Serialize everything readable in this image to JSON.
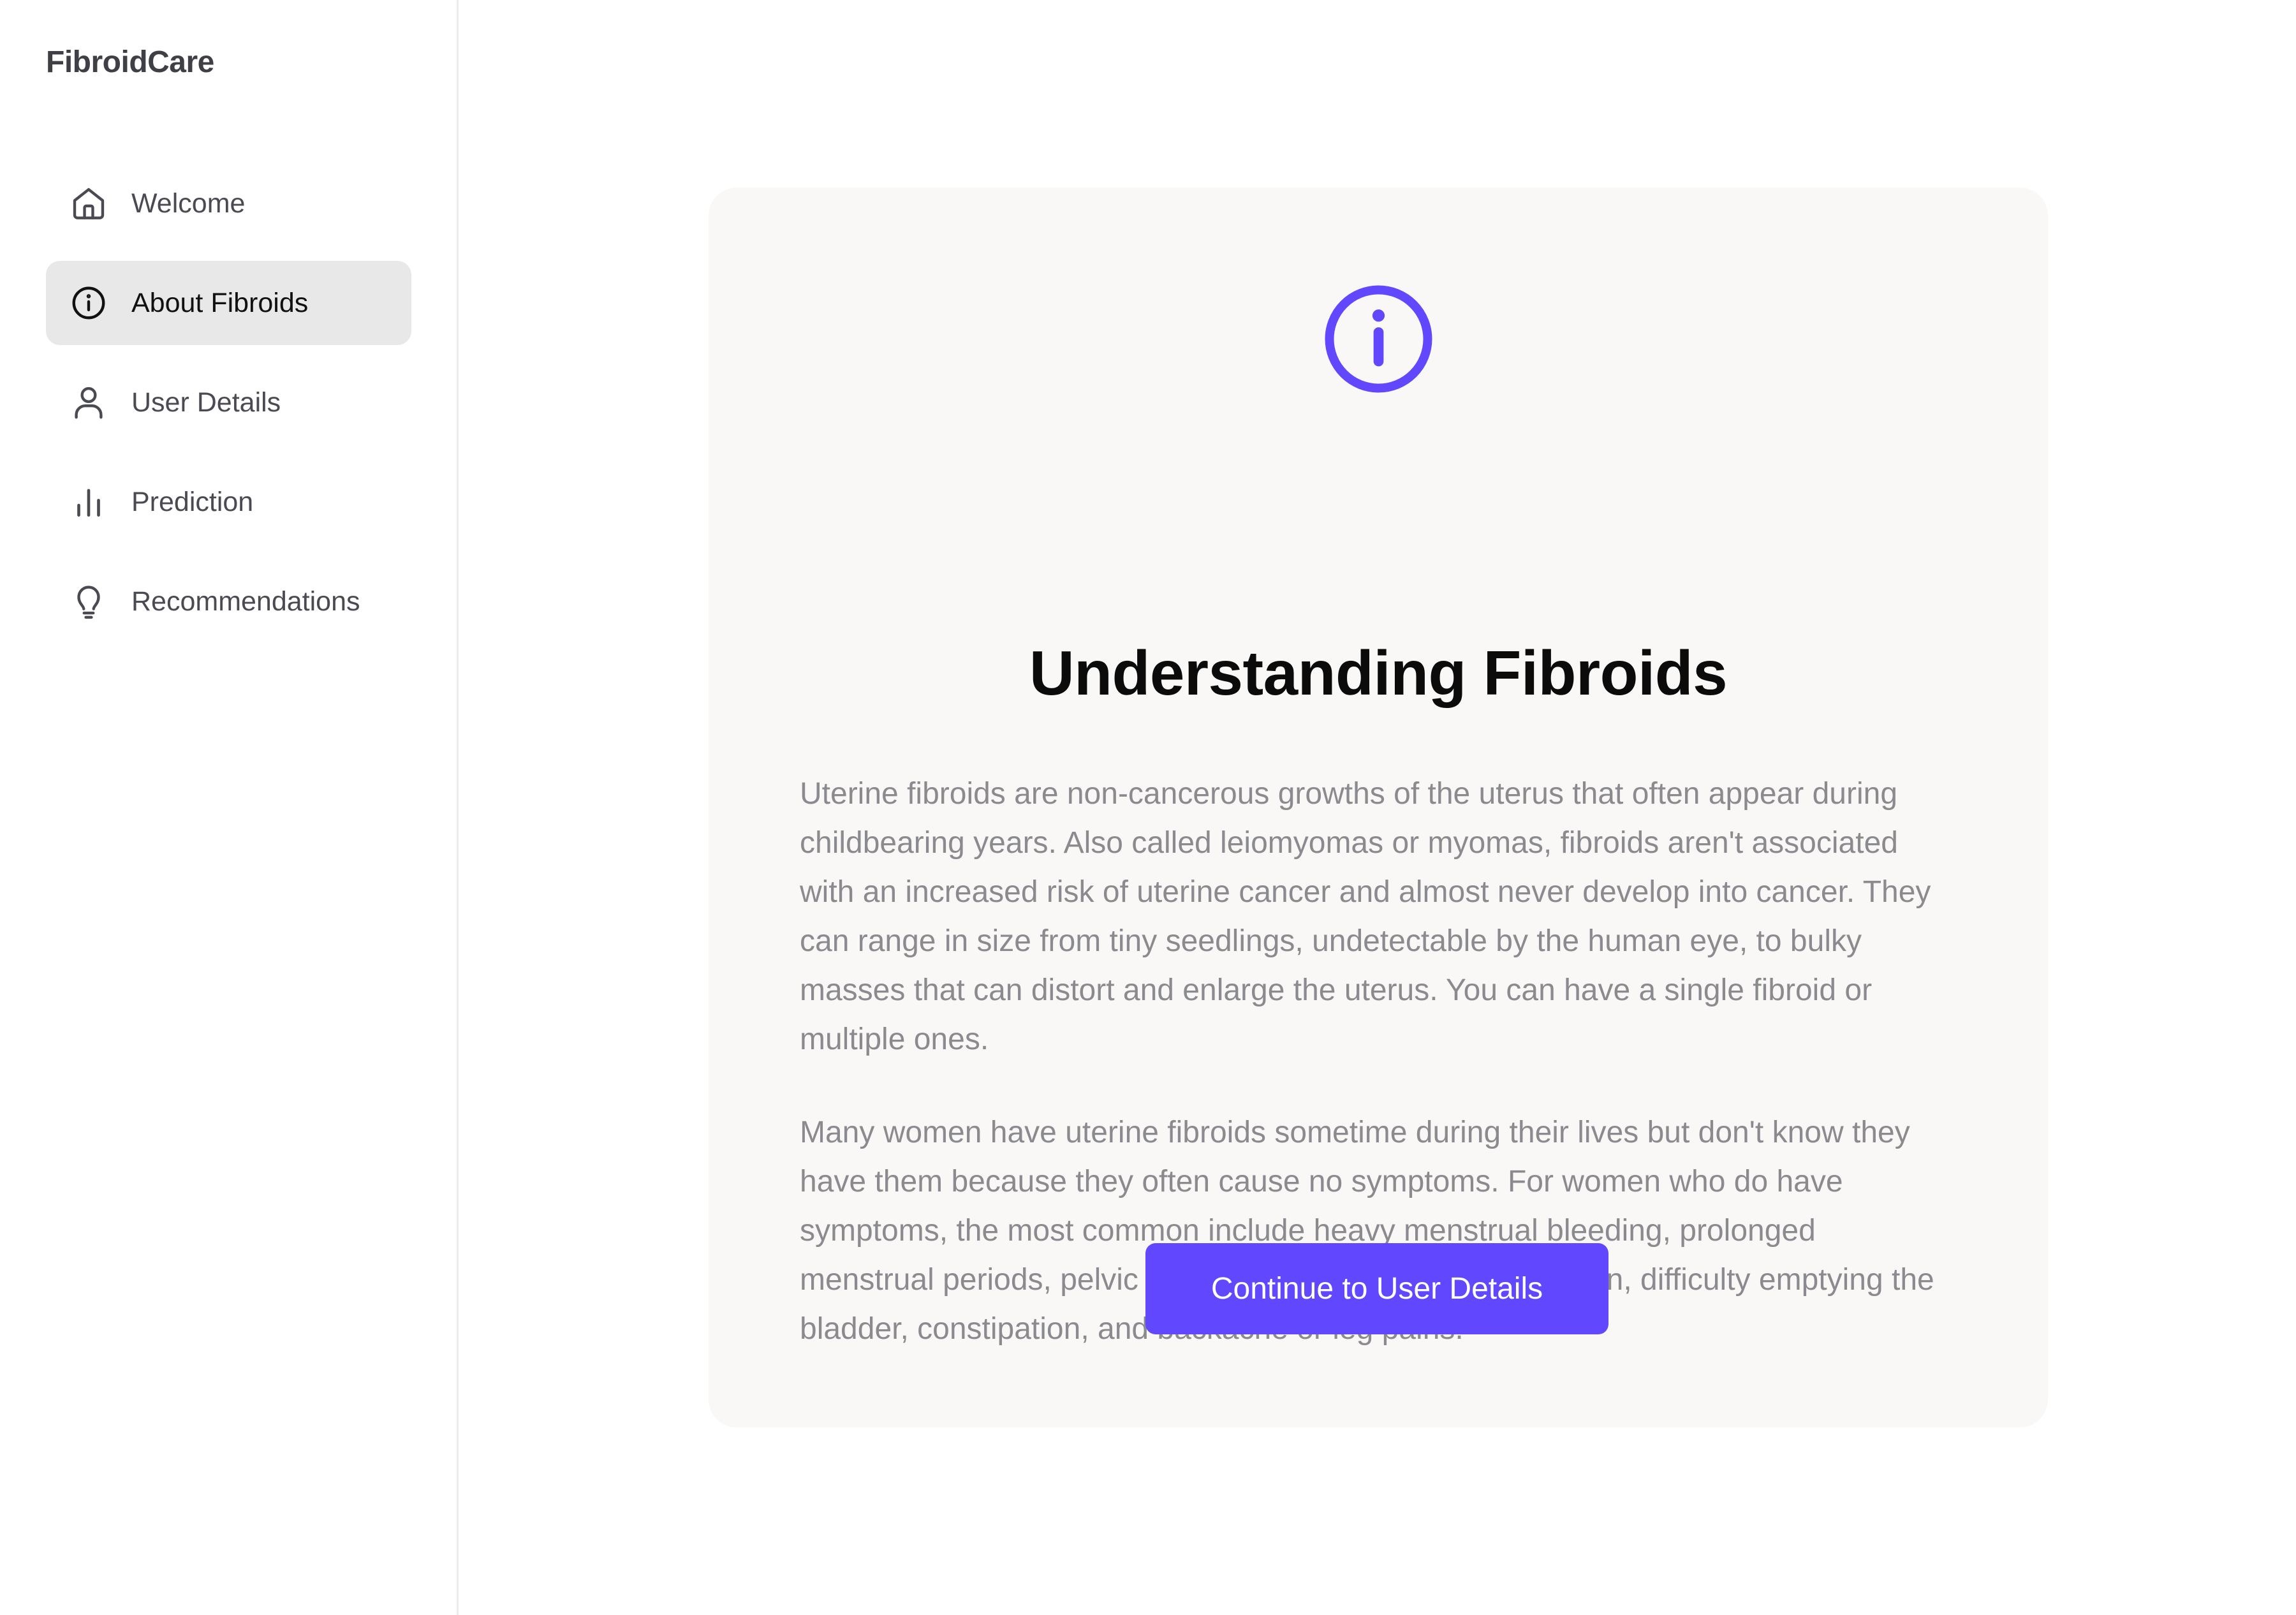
{
  "app": {
    "brand": "FibroidCare"
  },
  "sidebar": {
    "items": [
      {
        "label": "Welcome",
        "icon": "home-icon",
        "active": false
      },
      {
        "label": "About Fibroids",
        "icon": "info-icon",
        "active": true
      },
      {
        "label": "User Details",
        "icon": "user-icon",
        "active": false
      },
      {
        "label": "Prediction",
        "icon": "bar-chart-icon",
        "active": false
      },
      {
        "label": "Recommendations",
        "icon": "lightbulb-icon",
        "active": false
      }
    ]
  },
  "main": {
    "icon": "info-icon",
    "title": "Understanding Fibroids",
    "paragraphs": [
      "Uterine fibroids are non-cancerous growths of the uterus that often appear during childbearing years. Also called leiomyomas or myomas, fibroids aren't associated with an increased risk of uterine cancer and almost never develop into cancer. They can range in size from tiny seedlings, undetectable by the human eye, to bulky masses that can distort and enlarge the uterus. You can have a single fibroid or multiple ones.",
      "Many women have uterine fibroids sometime during their lives but don't know they have them because they often cause no symptoms. For women who do have symptoms, the most common include heavy menstrual bleeding, prolonged menstrual periods, pelvic pressure or pain, frequent urination, difficulty emptying the bladder, constipation, and backache or leg pains."
    ],
    "cta_label": "Continue to User Details"
  },
  "colors": {
    "accent": "#6148ff",
    "active_nav_bg": "#e8e8e8",
    "card_bg": "#f9f8f6",
    "body_text": "#8a8a8f"
  }
}
